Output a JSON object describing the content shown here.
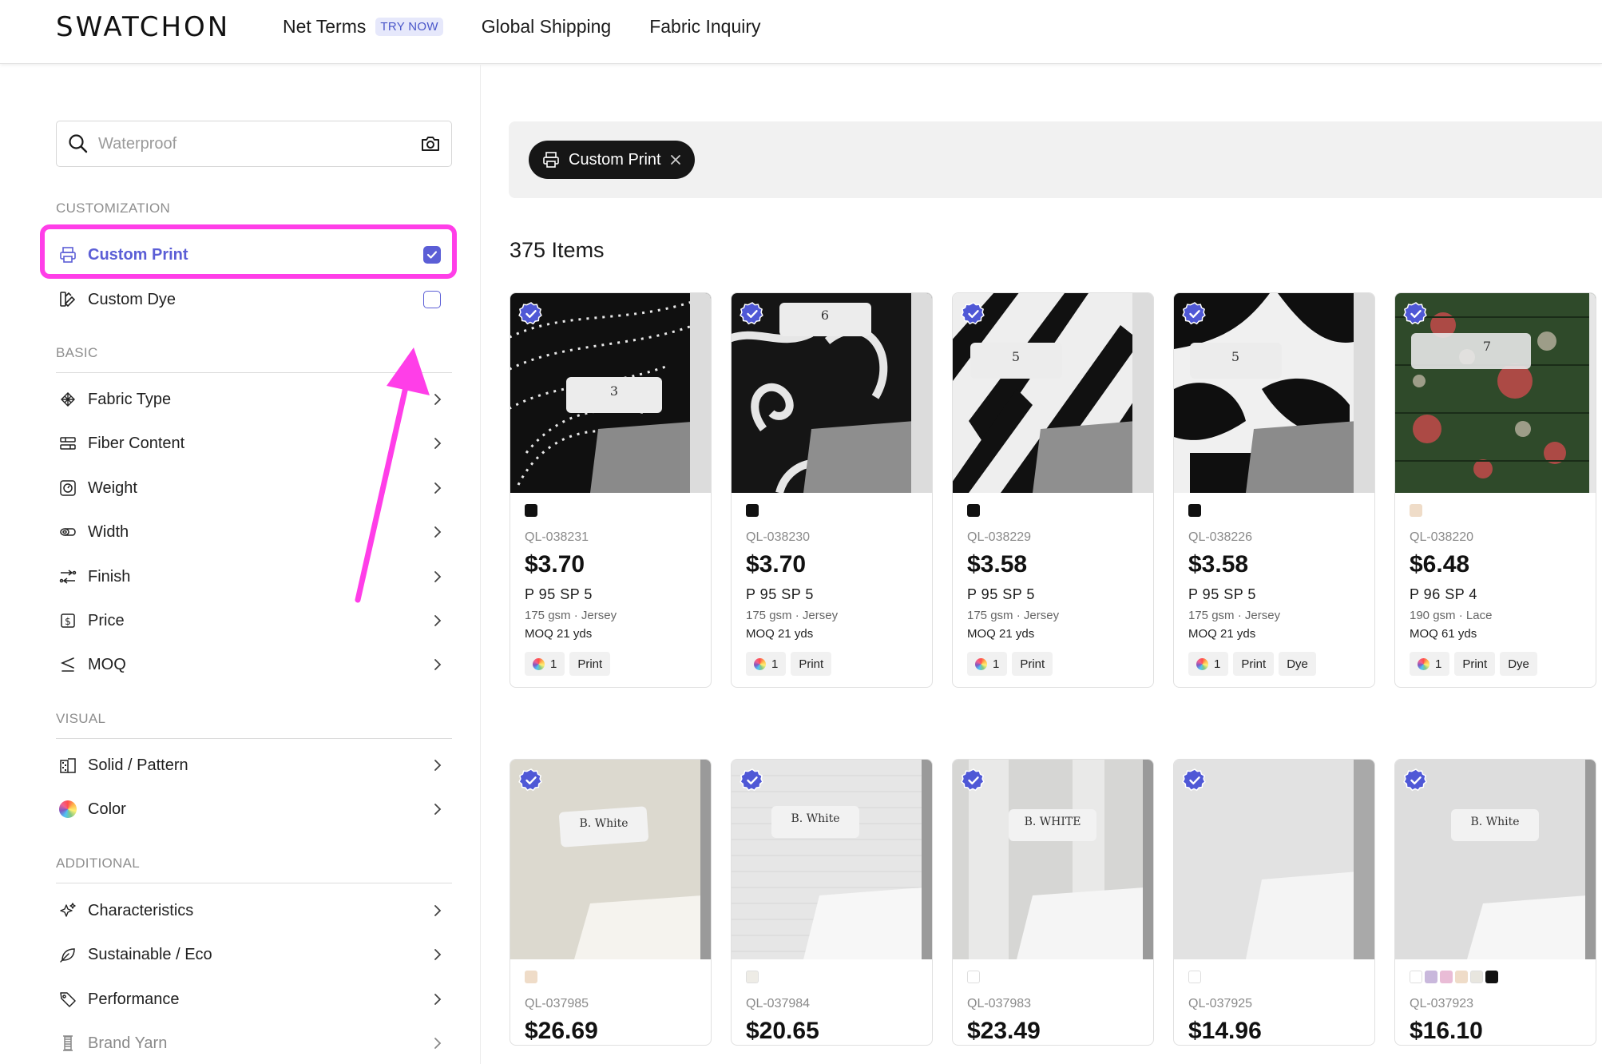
{
  "header": {
    "logo": "SWATCHON",
    "nav": [
      {
        "label": "Net Terms",
        "badge": "TRY NOW"
      },
      {
        "label": "Global Shipping"
      },
      {
        "label": "Fabric Inquiry"
      }
    ]
  },
  "sidebar": {
    "search_placeholder": "Waterproof",
    "customization_title": "CUSTOMIZATION",
    "customization": [
      {
        "label": "Custom Print",
        "checked": true
      },
      {
        "label": "Custom Dye",
        "checked": false
      }
    ],
    "basic_title": "BASIC",
    "basic": [
      {
        "label": "Fabric Type"
      },
      {
        "label": "Fiber Content"
      },
      {
        "label": "Weight"
      },
      {
        "label": "Width"
      },
      {
        "label": "Finish"
      },
      {
        "label": "Price"
      },
      {
        "label": "MOQ"
      }
    ],
    "visual_title": "VISUAL",
    "visual": [
      {
        "label": "Solid / Pattern"
      },
      {
        "label": "Color"
      }
    ],
    "additional_title": "ADDITIONAL",
    "additional": [
      {
        "label": "Characteristics"
      },
      {
        "label": "Sustainable / Eco"
      },
      {
        "label": "Performance"
      },
      {
        "label": "Brand Yarn"
      }
    ]
  },
  "main": {
    "active_chip": "Custom Print",
    "items_count": "375 Items",
    "products_row1": [
      {
        "tag_no": "3",
        "code": "QL-038231",
        "price": "$3.70",
        "comp": "P 95   SP 5",
        "gsm": "175 gsm",
        "type": "Jersey",
        "moq": "MOQ 21 yds",
        "color_count": "1",
        "tags": [
          "Print"
        ],
        "swatches": [
          "#111111"
        ]
      },
      {
        "tag_no": "6",
        "code": "QL-038230",
        "price": "$3.70",
        "comp": "P 95   SP 5",
        "gsm": "175 gsm",
        "type": "Jersey",
        "moq": "MOQ 21 yds",
        "color_count": "1",
        "tags": [
          "Print"
        ],
        "swatches": [
          "#111111"
        ]
      },
      {
        "tag_no": "5",
        "code": "QL-038229",
        "price": "$3.58",
        "comp": "P 95   SP 5",
        "gsm": "175 gsm",
        "type": "Jersey",
        "moq": "MOQ 21 yds",
        "color_count": "1",
        "tags": [
          "Print"
        ],
        "swatches": [
          "#111111"
        ]
      },
      {
        "tag_no": "5",
        "code": "QL-038226",
        "price": "$3.58",
        "comp": "P 95   SP 5",
        "gsm": "175 gsm",
        "type": "Jersey",
        "moq": "MOQ 21 yds",
        "color_count": "1",
        "tags": [
          "Print",
          "Dye"
        ],
        "swatches": [
          "#111111"
        ]
      },
      {
        "tag_no": "7",
        "code": "QL-038220",
        "price": "$6.48",
        "comp": "P 96   SP 4",
        "gsm": "190 gsm",
        "type": "Lace",
        "moq": "MOQ 61 yds",
        "color_count": "1",
        "tags": [
          "Print",
          "Dye"
        ],
        "swatches": [
          "#efdcc8"
        ]
      }
    ],
    "products_row2": [
      {
        "tag_no": "B. White",
        "code": "QL-037985",
        "price": "$26.69",
        "swatches": [
          "#efdcc8"
        ]
      },
      {
        "tag_no": "B. White",
        "code": "QL-037984",
        "price": "$20.65",
        "swatches": [
          "#eeece6"
        ]
      },
      {
        "tag_no": "B. WHITE",
        "code": "QL-037983",
        "price": "$23.49",
        "swatches": [
          "#ffffff"
        ]
      },
      {
        "tag_no": "",
        "code": "QL-037925",
        "price": "$14.96",
        "swatches": [
          "#ffffff"
        ]
      },
      {
        "tag_no": "B. White",
        "code": "QL-037923",
        "price": "$16.10",
        "swatches": [
          "#ffffff",
          "#c9b8dc",
          "#e9bcd6",
          "#efdcc8",
          "#e8e6df",
          "#111111"
        ]
      }
    ]
  },
  "colors": {
    "accent": "#5b5ed6",
    "highlight": "#ff3ee8",
    "chip_bg": "#161616"
  }
}
